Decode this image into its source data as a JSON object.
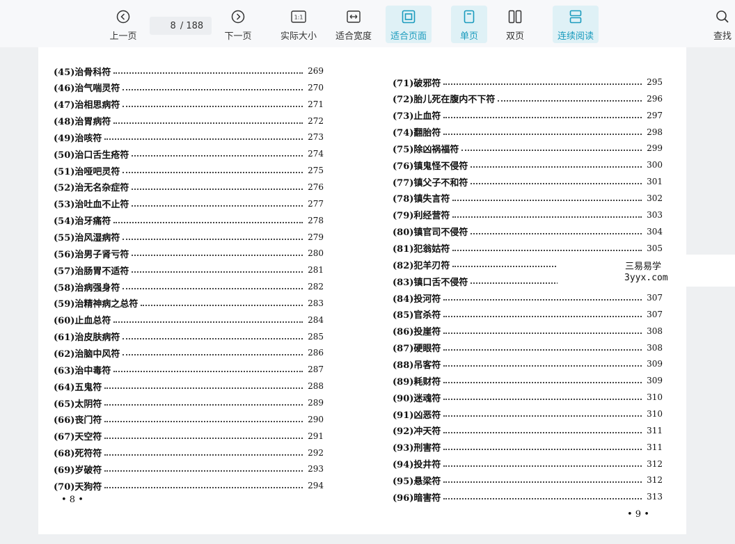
{
  "toolbar": {
    "prev": {
      "label": "上一页",
      "icon": "chevron-left-circle-icon"
    },
    "page_current": "8",
    "page_total": "/ 188",
    "next": {
      "label": "下一页",
      "icon": "chevron-right-circle-icon"
    },
    "actual_size": {
      "label": "实际大小",
      "icon_text": "1:1"
    },
    "fit_width": {
      "label": "适合宽度",
      "icon": "fit-width-icon"
    },
    "fit_page": {
      "label": "适合页面",
      "icon": "fit-page-icon"
    },
    "single_page": {
      "label": "单页",
      "icon": "single-page-icon"
    },
    "double_page": {
      "label": "双页",
      "icon": "double-page-icon"
    },
    "continuous": {
      "label": "连续阅读",
      "icon": "continuous-read-icon"
    },
    "search": {
      "label": "查找",
      "icon": "search-icon"
    },
    "accent_color": "#1a9bbd",
    "active_bg": "#dff1f6"
  },
  "left_page": {
    "entries": [
      {
        "title": "(45)治骨科符",
        "page": "269"
      },
      {
        "title": "(46)治气喘灵符",
        "page": "270"
      },
      {
        "title": "(47)治相思病符",
        "page": "271"
      },
      {
        "title": "(48)治胃病符",
        "page": "272"
      },
      {
        "title": "(49)治咳符",
        "page": "273"
      },
      {
        "title": "(50)治口舌生疮符",
        "page": "274"
      },
      {
        "title": "(51)治哑吧灵符",
        "page": "275"
      },
      {
        "title": "(52)治无名杂症符",
        "page": "276"
      },
      {
        "title": "(53)治吐血不止符",
        "page": "277"
      },
      {
        "title": "(54)治牙痛符",
        "page": "278"
      },
      {
        "title": "(55)治风湿病符",
        "page": "279"
      },
      {
        "title": "(56)治男子肾亏符",
        "page": "280"
      },
      {
        "title": "(57)治肠胃不适符",
        "page": "281"
      },
      {
        "title": "(58)治病强身符",
        "page": "282"
      },
      {
        "title": "(59)治精神病之总符",
        "page": "283"
      },
      {
        "title": "(60)止血总符",
        "page": "284"
      },
      {
        "title": "(61)治皮肤病符",
        "page": "285"
      },
      {
        "title": "(62)治脑中风符",
        "page": "286"
      },
      {
        "title": "(63)治中毒符",
        "page": "287"
      },
      {
        "title": "(64)五鬼符",
        "page": "288"
      },
      {
        "title": "(65)太阴符",
        "page": "289"
      },
      {
        "title": "(66)丧门符",
        "page": "290"
      },
      {
        "title": "(67)天空符",
        "page": "291"
      },
      {
        "title": "(68)死符符",
        "page": "292"
      },
      {
        "title": "(69)岁破符",
        "page": "293"
      },
      {
        "title": "(70)天狗符",
        "page": "294"
      }
    ],
    "folio": "• 8 •"
  },
  "right_page": {
    "entries": [
      {
        "title": "(71)破邪符",
        "page": "295"
      },
      {
        "title": "(72)胎儿死在腹内不下符",
        "page": "296"
      },
      {
        "title": "(73)止血符",
        "page": "297"
      },
      {
        "title": "(74)翻胎符",
        "page": "298"
      },
      {
        "title": "(75)除凶祸福符",
        "page": "299"
      },
      {
        "title": "(76)镇鬼怪不侵符",
        "page": "300"
      },
      {
        "title": "(77)镇父子不和符",
        "page": "301"
      },
      {
        "title": "(78)镇失言符",
        "page": "302"
      },
      {
        "title": "(79)利经营符",
        "page": "303"
      },
      {
        "title": "(80)镇官司不侵符",
        "page": "304"
      },
      {
        "title": "(81)犯翁姑符",
        "page": "305"
      },
      {
        "title": "(82)犯羊刃符",
        "page": ""
      },
      {
        "title": "(83)镇口舌不侵符",
        "page": ""
      },
      {
        "title": "(84)投河符",
        "page": "307"
      },
      {
        "title": "(85)官杀符",
        "page": "307"
      },
      {
        "title": "(86)投崖符",
        "page": "308"
      },
      {
        "title": "(87)硬眼符",
        "page": "308"
      },
      {
        "title": "(88)吊客符",
        "page": "309"
      },
      {
        "title": "(89)耗财符",
        "page": "309"
      },
      {
        "title": "(90)迷魂符",
        "page": "310"
      },
      {
        "title": "(91)凶恶符",
        "page": "310"
      },
      {
        "title": "(92)冲天符",
        "page": "311"
      },
      {
        "title": "(93)刑害符",
        "page": "311"
      },
      {
        "title": "(94)投井符",
        "page": "312"
      },
      {
        "title": "(95)悬梁符",
        "page": "312"
      },
      {
        "title": "(96)暗害符",
        "page": "313"
      }
    ],
    "folio": "• 9 •"
  },
  "watermark": {
    "line1": "三易易学",
    "line2": "3yyx.com"
  }
}
